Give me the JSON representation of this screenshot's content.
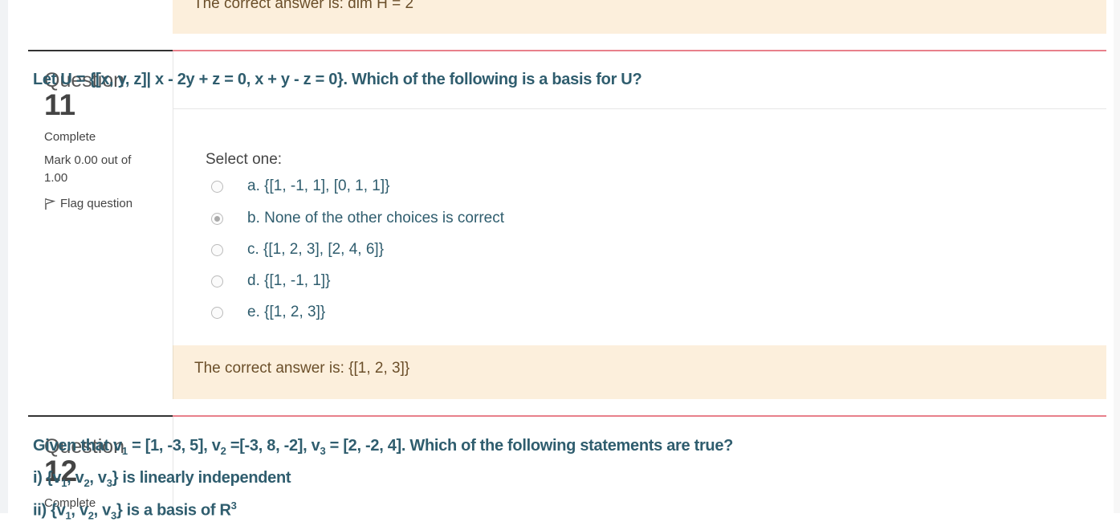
{
  "prev_feedback": "The correct answer is: dim H = 2",
  "q11": {
    "label": "Question",
    "number": "11",
    "state": "Complete",
    "grade": "Mark 0.00 out of 1.00",
    "flag": "Flag question",
    "text": "Let U = {[x, y, z]| x - 2y + z = 0, x + y - z = 0}. Which of the following is a basis for U?",
    "prompt": "Select one:",
    "options": [
      {
        "text": "a. {[1, -1, 1], [0, 1, 1]}",
        "checked": false
      },
      {
        "text": "b. None of the other choices is correct",
        "checked": true
      },
      {
        "text": "c. {[1, 2, 3], [2, 4, 6]}",
        "checked": false
      },
      {
        "text": "d. {[1, -1, 1]}",
        "checked": false
      },
      {
        "text": "e. {[1, 2, 3]}",
        "checked": false
      }
    ],
    "feedback": "The correct answer is: {[1, 2, 3]}"
  },
  "q12": {
    "label": "Question",
    "number": "12",
    "state": "Complete",
    "line1_prefix": "Given that v",
    "line1_s1": "1",
    "line1_a": " = [1, -3, 5], v",
    "line1_s2": "2",
    "line1_b": " =[-3, 8, -2], v",
    "line1_s3": "3",
    "line1_c": " = [2, -2, 4]. Which of the following statements are true?",
    "line2_a": "i) {v",
    "line2_s1": "1",
    "line2_b": ", v",
    "line2_s2": "2",
    "line2_c": ", v",
    "line2_s3": "3",
    "line2_d": "} is linearly independent",
    "line3_a": "ii) {v",
    "line3_s1": "1",
    "line3_b": ", v",
    "line3_s2": "2",
    "line3_c": ", v",
    "line3_s3": "3",
    "line3_d": "} is a basis of R",
    "line3_sup": "3"
  }
}
